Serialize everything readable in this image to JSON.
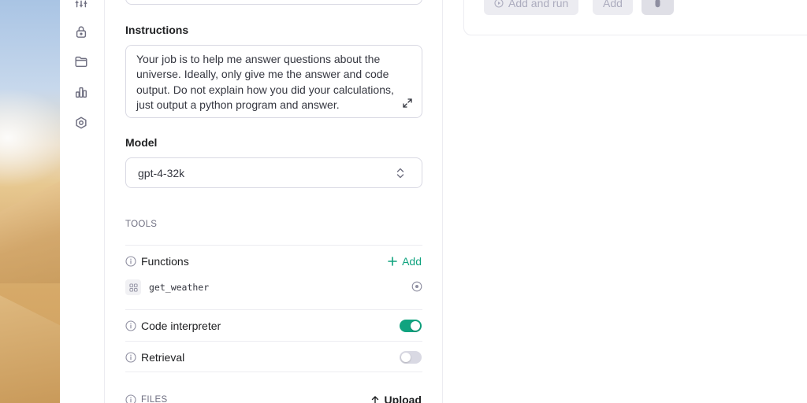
{
  "instructions": {
    "label": "Instructions",
    "value": "Your job is to help me answer questions about the universe. Ideally, only give me the answer and code output. Do not explain how you did your calculations, just output a python program and answer."
  },
  "model": {
    "label": "Model",
    "value": "gpt-4-32k"
  },
  "tools": {
    "heading": "TOOLS",
    "functions": {
      "label": "Functions",
      "add_label": "Add",
      "items": [
        "get_weather"
      ]
    },
    "code_interpreter": {
      "label": "Code interpreter",
      "enabled": true
    },
    "retrieval": {
      "label": "Retrieval",
      "enabled": false
    }
  },
  "files": {
    "heading": "FILES",
    "upload_label": "Upload"
  },
  "workspace": {
    "add_and_run_label": "Add and run",
    "add_label": "Add"
  },
  "rail_icons": [
    "sliders-icon",
    "lock-icon",
    "folder-icon",
    "bar-chart-icon",
    "settings-icon"
  ],
  "colors": {
    "accent": "#10a37f",
    "border": "#d9d9e3",
    "muted": "#6e6e80"
  }
}
